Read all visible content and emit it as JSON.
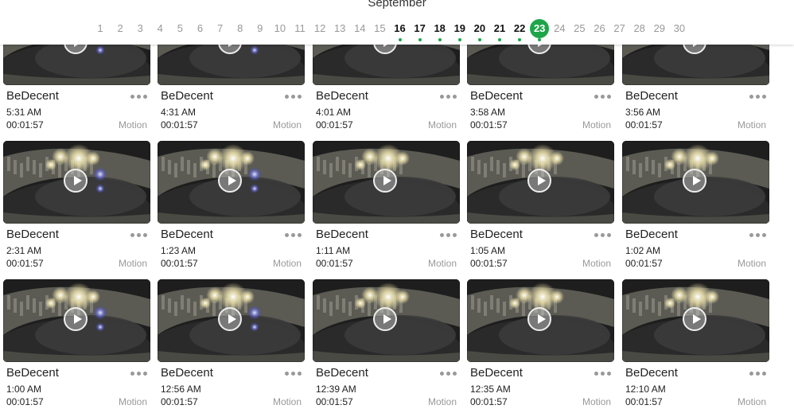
{
  "calendar": {
    "month": "September",
    "days": [
      "1",
      "2",
      "3",
      "4",
      "5",
      "6",
      "7",
      "8",
      "9",
      "10",
      "11",
      "12",
      "13",
      "14",
      "15",
      "16",
      "17",
      "18",
      "19",
      "20",
      "21",
      "22",
      "23",
      "24",
      "25",
      "26",
      "27",
      "28",
      "29",
      "30"
    ],
    "days_with_events": [
      "16",
      "17",
      "18",
      "19",
      "20",
      "21",
      "22",
      "23"
    ],
    "selected_day": "23",
    "accent_color": "#1ea54a"
  },
  "recordings": [
    {
      "camera": "BeDecent",
      "time": "5:31 AM",
      "duration": "00:01:57",
      "event_type": "Motion"
    },
    {
      "camera": "BeDecent",
      "time": "4:31 AM",
      "duration": "00:01:57",
      "event_type": "Motion"
    },
    {
      "camera": "BeDecent",
      "time": "4:01 AM",
      "duration": "00:01:57",
      "event_type": "Motion"
    },
    {
      "camera": "BeDecent",
      "time": "3:58 AM",
      "duration": "00:01:57",
      "event_type": "Motion"
    },
    {
      "camera": "BeDecent",
      "time": "3:56 AM",
      "duration": "00:01:57",
      "event_type": "Motion"
    },
    {
      "camera": "BeDecent",
      "time": "2:31 AM",
      "duration": "00:01:57",
      "event_type": "Motion"
    },
    {
      "camera": "BeDecent",
      "time": "1:23 AM",
      "duration": "00:01:57",
      "event_type": "Motion"
    },
    {
      "camera": "BeDecent",
      "time": "1:11 AM",
      "duration": "00:01:57",
      "event_type": "Motion"
    },
    {
      "camera": "BeDecent",
      "time": "1:05 AM",
      "duration": "00:01:57",
      "event_type": "Motion"
    },
    {
      "camera": "BeDecent",
      "time": "1:02 AM",
      "duration": "00:01:57",
      "event_type": "Motion"
    },
    {
      "camera": "BeDecent",
      "time": "1:00 AM",
      "duration": "00:01:57",
      "event_type": "Motion"
    },
    {
      "camera": "BeDecent",
      "time": "12:56 AM",
      "duration": "00:01:57",
      "event_type": "Motion"
    },
    {
      "camera": "BeDecent",
      "time": "12:39 AM",
      "duration": "00:01:57",
      "event_type": "Motion"
    },
    {
      "camera": "BeDecent",
      "time": "12:35 AM",
      "duration": "00:01:57",
      "event_type": "Motion"
    },
    {
      "camera": "BeDecent",
      "time": "12:10 AM",
      "duration": "00:01:57",
      "event_type": "Motion"
    }
  ],
  "icons": {
    "play": "play-icon",
    "more": "more-options-icon"
  }
}
